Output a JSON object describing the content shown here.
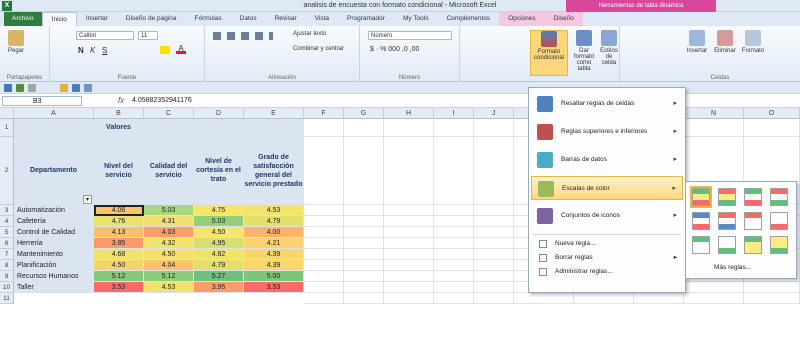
{
  "window": {
    "title": "analisis de encuesta con formato condicional - Microsoft Excel",
    "context_group": "Herramientas de tabla dinámica"
  },
  "tabs": [
    "Archivo",
    "Inicio",
    "Insertar",
    "Diseño de página",
    "Fórmulas",
    "Datos",
    "Revisar",
    "Vista",
    "Programador",
    "My Tools",
    "Complementos",
    "Opciones",
    "Diseño"
  ],
  "ribbon": {
    "paste": "Pegar",
    "font_name": "Calibri",
    "font_size": "11",
    "wrap": "Ajustar texto",
    "merge": "Combinar y centrar",
    "number_format": "Número",
    "cond_format": "Formato condicional",
    "table_format": "Dar formato como tabla",
    "cell_styles": "Estilos de celda",
    "insert": "Insertar",
    "delete": "Eliminar",
    "format": "Formato",
    "groups": [
      "Portapapeles",
      "Fuente",
      "Alineación",
      "Número",
      "Celdas"
    ]
  },
  "formula_bar": {
    "cell": "B3",
    "fx": "fx",
    "value": "4.05882352941176"
  },
  "columns": [
    "A",
    "B",
    "C",
    "D",
    "E",
    "F",
    "G",
    "H",
    "I",
    "J",
    "K",
    "L",
    "M",
    "N",
    "O"
  ],
  "rows": [
    "1",
    "2",
    "3",
    "4",
    "5",
    "6",
    "7",
    "8",
    "9",
    "10",
    "11"
  ],
  "sheet": {
    "valores": "Valores",
    "headers": [
      "Departamento",
      "Nivel del servicio",
      "Calidad del servicio",
      "Nivel de cortesía en el trato",
      "Grado de satisfacción general del servicio prestado"
    ],
    "data": [
      [
        "Automatización",
        "4.06",
        "5.03",
        "4.75",
        "4.53"
      ],
      [
        "Cafetería",
        "4.76",
        "4.31",
        "5.03",
        "4.79"
      ],
      [
        "Control de Calidad",
        "4.13",
        "4.03",
        "4.50",
        "4.00"
      ],
      [
        "Herrería",
        "3.85",
        "4.32",
        "4.95",
        "4.21"
      ],
      [
        "Mantenimiento",
        "4.68",
        "4.50",
        "4.82",
        "4.39"
      ],
      [
        "Planificación",
        "4.50",
        "4.04",
        "4.79",
        "4.39"
      ],
      [
        "Recursos Humanos",
        "5.12",
        "5.12",
        "5.27",
        "5.00"
      ],
      [
        "Taller",
        "3.53",
        "4.53",
        "3.95",
        "3.53"
      ]
    ],
    "colors": [
      [
        "#f8c56b",
        "#a8d87e",
        "#f6e56b",
        "#f3e36e"
      ],
      [
        "#e9e26b",
        "#f3df70",
        "#92d07b",
        "#e5e06c"
      ],
      [
        "#f8c06a",
        "#fa9e6a",
        "#f4e66c",
        "#fcb36c"
      ],
      [
        "#fb9a69",
        "#f2e16c",
        "#d7e06e",
        "#fcd26e"
      ],
      [
        "#eee16c",
        "#f6e06c",
        "#eee36b",
        "#f8d66c"
      ],
      [
        "#f2d46c",
        "#f8c36c",
        "#e3df6c",
        "#f8d66c"
      ],
      [
        "#84c97a",
        "#8ccc7b",
        "#6fc07a",
        "#7cc67a"
      ],
      [
        "#f8696b",
        "#f2e16c",
        "#fb9d69",
        "#f86a6b"
      ]
    ]
  },
  "menu": {
    "items": [
      "Resaltar reglas de celdas",
      "Reglas superiores e inferiores",
      "Barras de datos",
      "Escalas de color",
      "Conjuntos de iconos"
    ],
    "small": [
      "Nueva regla...",
      "Borrar reglas",
      "Administrar reglas..."
    ],
    "more_rules": "Más reglas..."
  },
  "scales": [
    [
      "#63be7b",
      "#ffeb84",
      "#f8696b"
    ],
    [
      "#f8696b",
      "#ffeb84",
      "#63be7b"
    ],
    [
      "#63be7b",
      "#fcfcff",
      "#f8696b"
    ],
    [
      "#f8696b",
      "#fcfcff",
      "#63be7b"
    ],
    [
      "#5a8ac6",
      "#fcfcff",
      "#f8696b"
    ],
    [
      "#f8696b",
      "#fcfcff",
      "#5a8ac6"
    ],
    [
      "#f8696b",
      "#fcfcff",
      "#fcfcff"
    ],
    [
      "#fcfcff",
      "#fcfcff",
      "#f8696b"
    ],
    [
      "#63be7b",
      "#fcfcff",
      "#fcfcff"
    ],
    [
      "#fcfcff",
      "#fcfcff",
      "#63be7b"
    ],
    [
      "#63be7b",
      "#ffeb84",
      "#ffeb84"
    ],
    [
      "#ffeb84",
      "#ffeb84",
      "#63be7b"
    ]
  ]
}
